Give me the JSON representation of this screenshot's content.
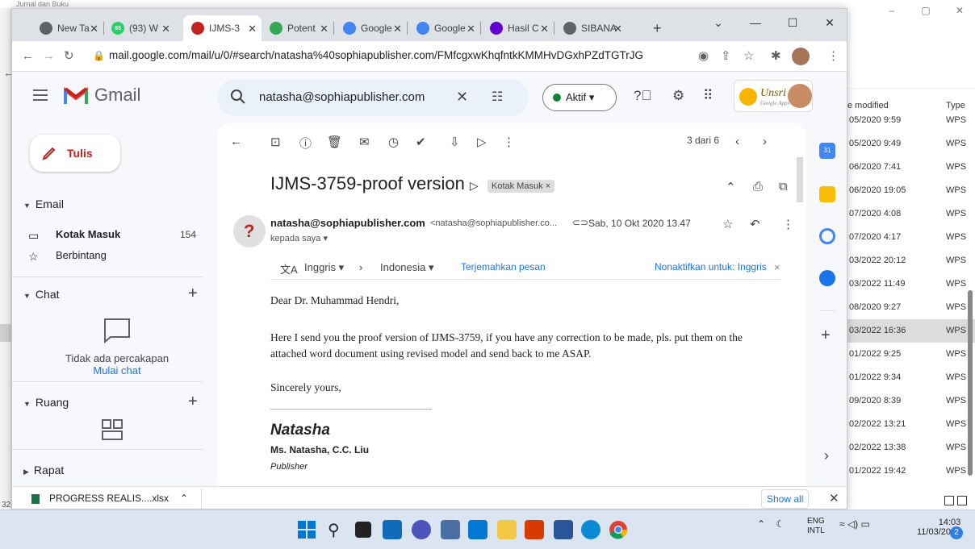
{
  "explorer": {
    "title": "Jurnal dan Buku",
    "column_date": "e modified",
    "column_type": "Type",
    "left_number": "32",
    "rows": [
      {
        "date": "05/2020 9:59",
        "type": "WPS"
      },
      {
        "date": "05/2020 9:49",
        "type": "WPS"
      },
      {
        "date": "06/2020 7:41",
        "type": "WPS"
      },
      {
        "date": "06/2020 19:05",
        "type": "WPS"
      },
      {
        "date": "07/2020 4:08",
        "type": "WPS"
      },
      {
        "date": "07/2020 4:17",
        "type": "WPS"
      },
      {
        "date": "03/2022 20:12",
        "type": "WPS"
      },
      {
        "date": "03/2022 11:49",
        "type": "WPS"
      },
      {
        "date": "08/2020 9:27",
        "type": "WPS"
      },
      {
        "date": "03/2022 16:36",
        "type": "WPS"
      },
      {
        "date": "01/2022 9:25",
        "type": "WPS"
      },
      {
        "date": "01/2022 9:34",
        "type": "WPS"
      },
      {
        "date": "09/2020 8:39",
        "type": "WPS"
      },
      {
        "date": "02/2022 13:21",
        "type": "WPS"
      },
      {
        "date": "02/2022 13:38",
        "type": "WPS"
      },
      {
        "date": "01/2022 19:42",
        "type": "WPS"
      }
    ]
  },
  "browser": {
    "tabs": [
      {
        "label": "New Ta",
        "icon": "chrome-icon",
        "color": "#5f6368"
      },
      {
        "label": "(93) W",
        "icon": "whatsapp-icon",
        "color": "#25d366",
        "badge": "93"
      },
      {
        "label": "IJMS-3",
        "icon": "gmail-icon",
        "color": "#c5221f"
      },
      {
        "label": "Potent",
        "icon": "drive-icon",
        "color": "#34a853"
      },
      {
        "label": "Google",
        "icon": "docs-icon",
        "color": "#4285f4"
      },
      {
        "label": "Google",
        "icon": "docs-icon",
        "color": "#4285f4"
      },
      {
        "label": "Hasil C",
        "icon": "yahoo-icon",
        "color": "#6001d2"
      },
      {
        "label": "SIBANA",
        "icon": "chrome-icon",
        "color": "#5f6368"
      }
    ],
    "url": "mail.google.com/mail/u/0/#search/natasha%40sophiapublisher.com/FMfcgxwKhqfntkKMMHvDGxhPZdTGTrJG"
  },
  "gmail": {
    "app_name": "Gmail",
    "search_query": "natasha@sophiapublisher.com",
    "status": "Aktif",
    "brand_text": "Unsri",
    "brand_sub": "Google Apps",
    "compose_label": "Tulis",
    "sections": {
      "email": "Email",
      "chat": "Chat",
      "ruang": "Ruang",
      "rapat": "Rapat"
    },
    "nav": [
      {
        "label": "Kotak Masuk",
        "count": "154",
        "icon": "inbox-icon"
      },
      {
        "label": "Berbintang",
        "count": "",
        "icon": "star-icon"
      }
    ],
    "chat_empty": "Tidak ada percakapan",
    "chat_start": "Mulai chat",
    "page_info": "3 dari 6",
    "message": {
      "subject": "IJMS-3759-proof version",
      "label": "Kotak Masuk",
      "sender_name": "natasha@sophiapublisher.com",
      "sender_email": "<natasha@sophiapublisher.co...",
      "date": "Sab, 10 Okt 2020 13.47",
      "recipient": "kepada saya",
      "translate": {
        "from": "Inggris",
        "to": "Indonesia",
        "action": "Terjemahkan pesan",
        "disable": "Nonaktifkan untuk: Inggris"
      },
      "greeting": "Dear Dr. Muhammad Hendri,",
      "body_line1": "Here I send you the proof version of IJMS-3759, if you have any correction to be made, pls. put them on the",
      "body_line2": "attached word document using revised model and send back to me ASAP.",
      "closing": "Sincerely yours,",
      "sig_name": "Natasha",
      "sig_full": "Ms. Natasha, C.C. Liu",
      "sig_title": "Publisher"
    }
  },
  "download": {
    "filename": "PROGRESS REALIS....xlsx",
    "show_all": "Show all"
  },
  "taskbar": {
    "lang": "ENG",
    "lang_sub": "INTL",
    "time": "14:03",
    "date": "11/03/2022",
    "notifications": "2"
  }
}
